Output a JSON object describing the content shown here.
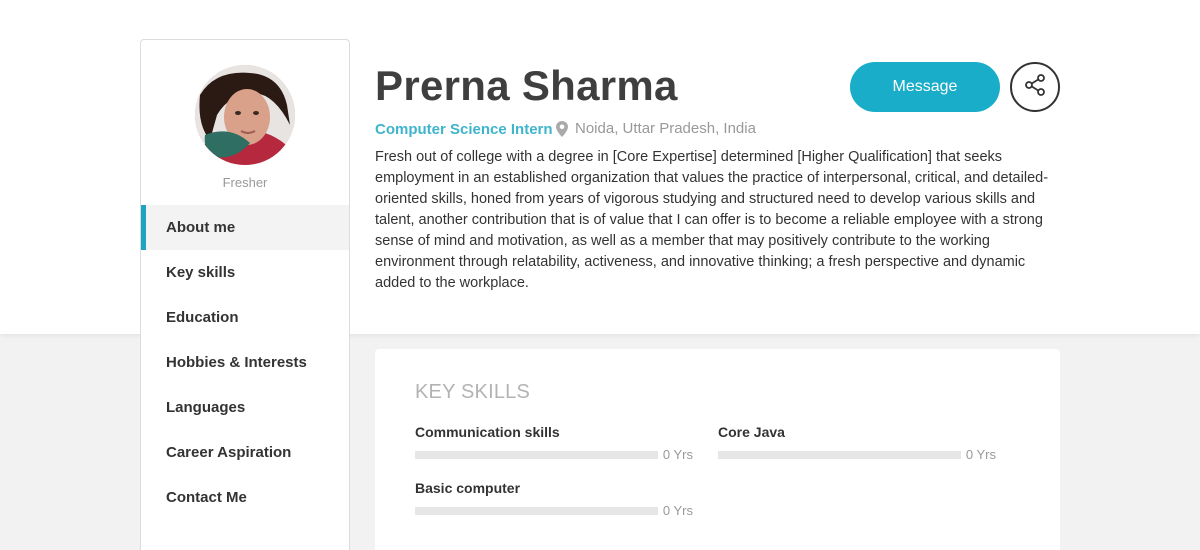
{
  "profile": {
    "name": "Prerna Sharma",
    "role": "Computer Science Intern",
    "location": "Noida, Uttar Pradesh, India",
    "status": "Fresher",
    "about": "Fresh out of college with a degree in [Core Expertise] determined [Higher Qualification] that seeks employment in an established organization that values the practice of interpersonal, critical, and detailed-oriented skills, honed from years of vigorous studying and structured need to develop various skills and talent, another contribution that is of value that I can offer is to become a reliable employee with a strong sense of mind and motivation, as well as a member that may positively contribute to the working environment through relatability, activeness, and innovative thinking; a fresh perspective and dynamic added to the workplace."
  },
  "actions": {
    "message_label": "Message",
    "share_icon": "share-icon"
  },
  "sidebar": {
    "items": [
      {
        "label": "About me",
        "active": true
      },
      {
        "label": "Key skills",
        "active": false
      },
      {
        "label": "Education",
        "active": false
      },
      {
        "label": "Hobbies & Interests",
        "active": false
      },
      {
        "label": "Languages",
        "active": false
      },
      {
        "label": "Career Aspiration",
        "active": false
      },
      {
        "label": "Contact Me",
        "active": false
      }
    ]
  },
  "skills": {
    "title": "KEY SKILLS",
    "items": [
      {
        "name": "Communication skills",
        "years": "0 Yrs",
        "level": 0
      },
      {
        "name": "Core Java",
        "years": "0 Yrs",
        "level": 0
      },
      {
        "name": "Basic computer",
        "years": "0 Yrs",
        "level": 0
      }
    ]
  },
  "colors": {
    "accent": "#19adc9",
    "role_text": "#3fb4cc",
    "active_border": "#1fa4bf"
  }
}
